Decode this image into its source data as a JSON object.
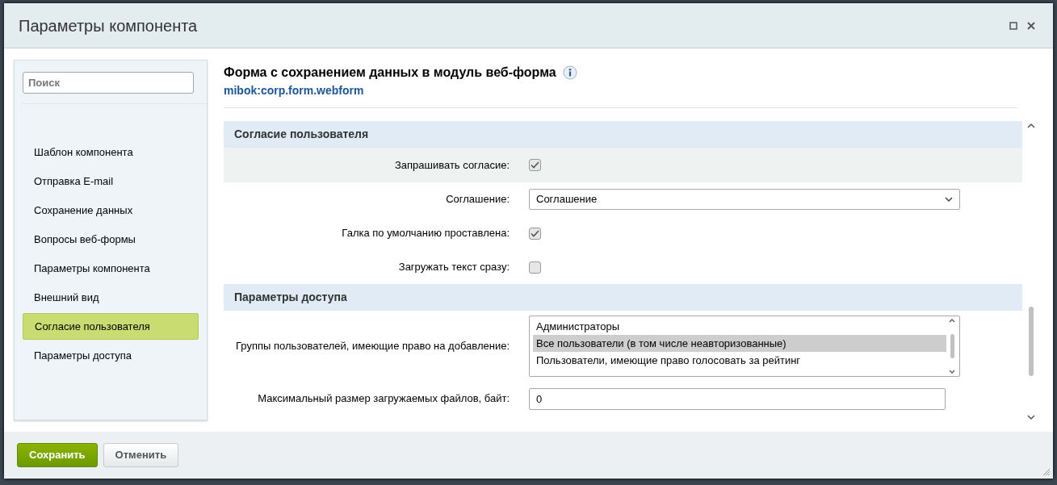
{
  "window": {
    "title": "Параметры компонента"
  },
  "search": {
    "placeholder": "Поиск"
  },
  "sidebar": {
    "items": [
      {
        "label": "Шаблон компонента",
        "selected": false
      },
      {
        "label": "Отправка E-mail",
        "selected": false
      },
      {
        "label": "Сохранение данных",
        "selected": false
      },
      {
        "label": "Вопросы веб-формы",
        "selected": false
      },
      {
        "label": "Параметры компонента",
        "selected": false
      },
      {
        "label": "Внешний вид",
        "selected": false
      },
      {
        "label": "Согласие пользователя",
        "selected": true
      },
      {
        "label": "Параметры доступа",
        "selected": false
      }
    ]
  },
  "component": {
    "title": "Форма с сохранением данных в модуль веб-форма",
    "code": "mibok:corp.form.webform"
  },
  "sections": [
    {
      "title": "Согласие пользователя",
      "rows": [
        {
          "kind": "checkbox",
          "label": "Запрашивать согласие:",
          "checked": true,
          "highlighted": true
        },
        {
          "kind": "select",
          "label": "Соглашение:",
          "value": "Соглашение",
          "highlighted": false
        },
        {
          "kind": "checkbox",
          "label": "Галка по умолчанию проставлена:",
          "checked": true,
          "highlighted": false
        },
        {
          "kind": "checkbox",
          "label": "Загружать текст сразу:",
          "checked": false,
          "highlighted": false
        }
      ]
    },
    {
      "title": "Параметры доступа",
      "rows": [
        {
          "kind": "listbox",
          "label": "Группы пользователей, имеющие право на добавление:",
          "highlighted": false,
          "options": [
            {
              "label": "Администраторы",
              "selected": false
            },
            {
              "label": "Все пользователи (в том числе неавторизованные)",
              "selected": true
            },
            {
              "label": "Пользователи, имеющие право голосовать за рейтинг",
              "selected": false
            }
          ]
        },
        {
          "kind": "text",
          "label": "Максимальный размер загружаемых файлов, байт:",
          "value": "0",
          "highlighted": false
        }
      ]
    }
  ],
  "buttons": [
    {
      "label": "Сохранить",
      "kind": "primary"
    },
    {
      "label": "Отменить",
      "kind": "secondary"
    }
  ]
}
